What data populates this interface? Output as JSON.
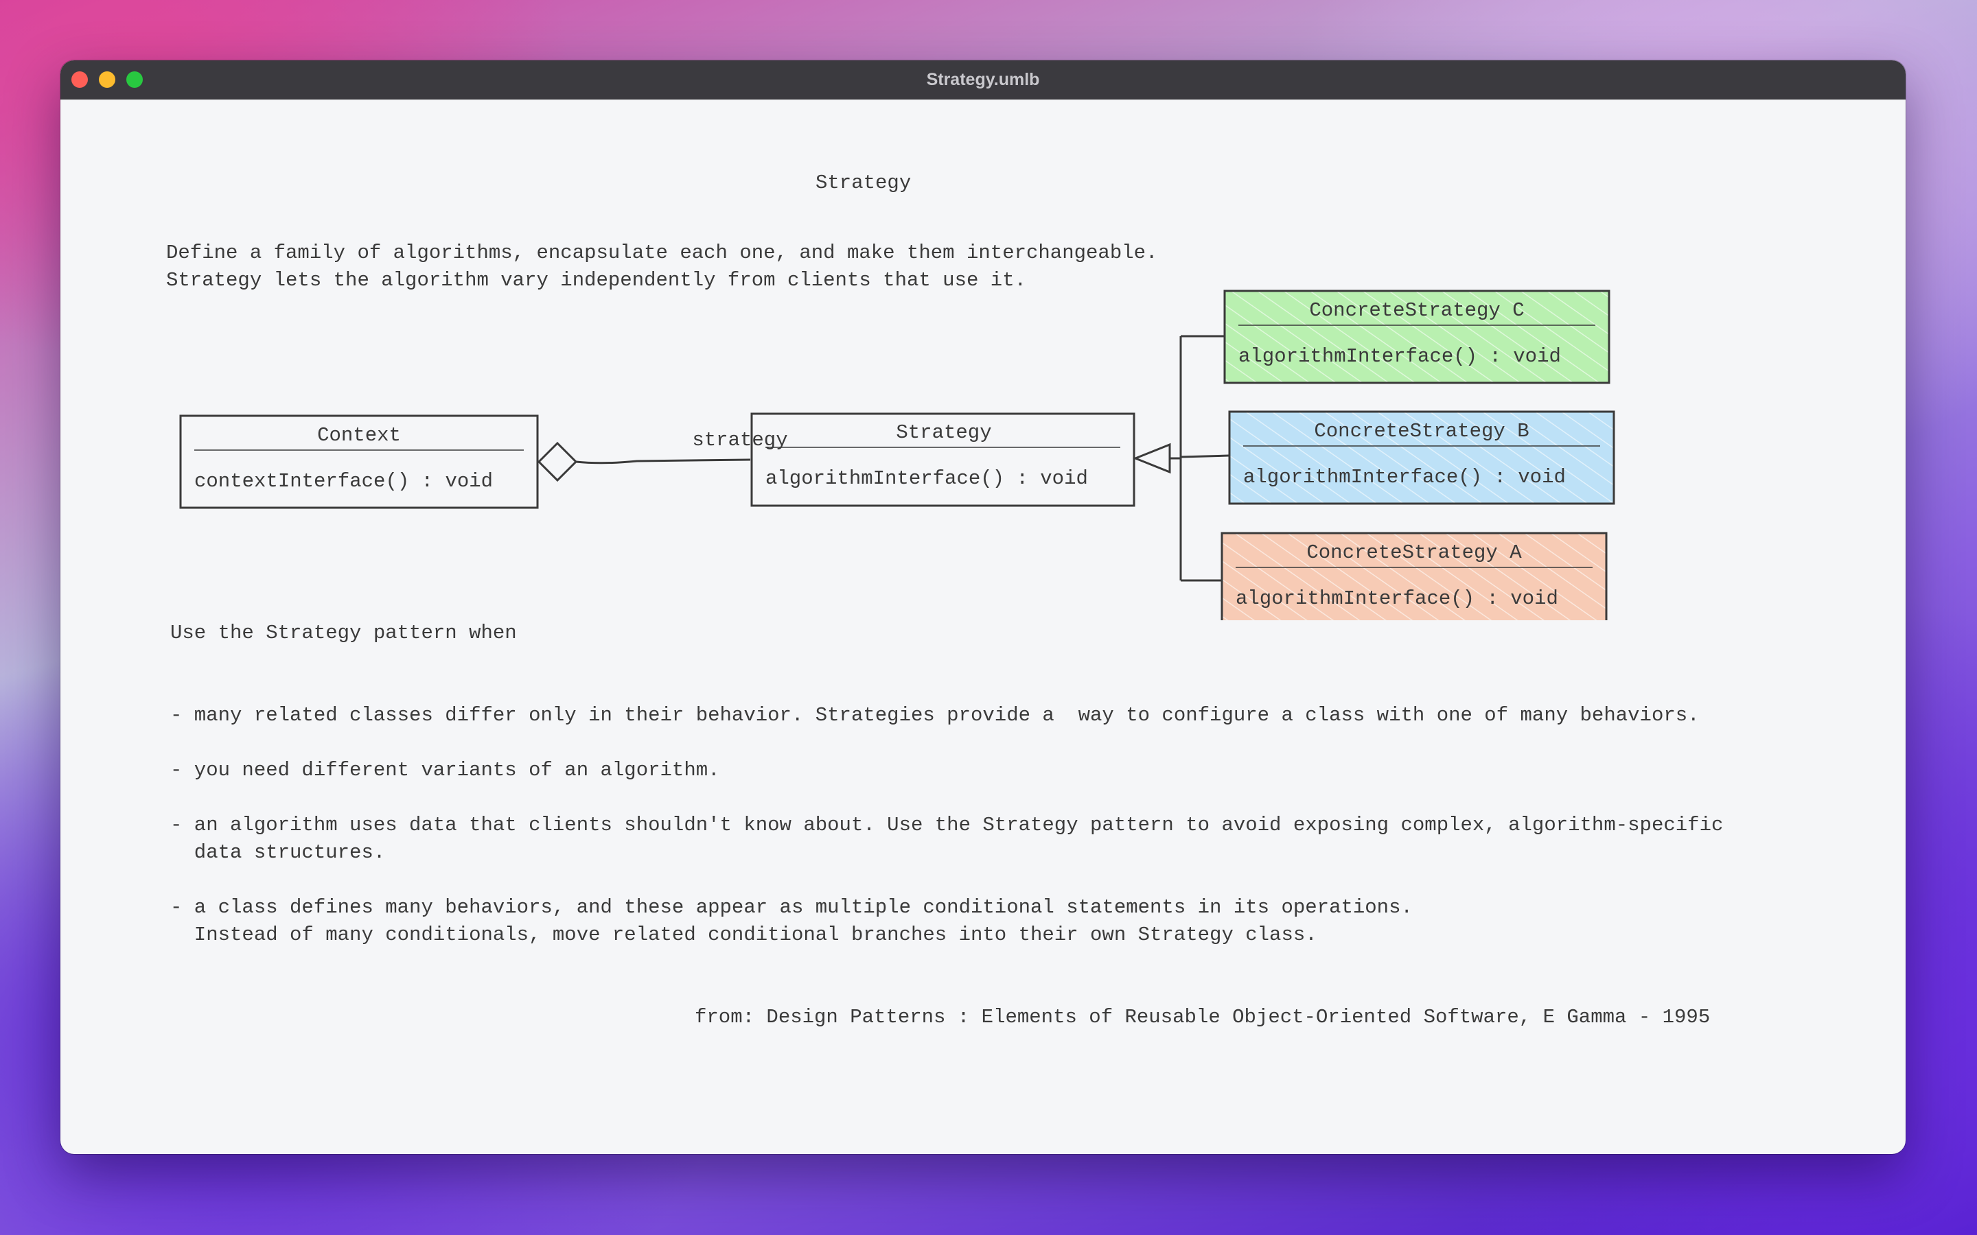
{
  "window": {
    "title": "Strategy.umlb"
  },
  "doc": {
    "heading": "Strategy",
    "intro": [
      "Define a family of algorithms, encapsulate each one, and make them interchangeable.",
      "Strategy lets the algorithm vary independently from clients that use it."
    ],
    "use_when": "Use the Strategy pattern when",
    "bullets": [
      "- many related classes differ only in their behavior. Strategies provide a  way to configure a class with one of many behaviors.",
      "- you need different variants of an algorithm.",
      "- an algorithm uses data that clients shouldn't know about. Use the Strategy pattern to avoid exposing complex, algorithm-specific",
      "  data structures.",
      "- a class defines many behaviors, and these appear as multiple conditional statements in its operations.",
      "  Instead of many conditionals, move related conditional branches into their own Strategy class."
    ],
    "citation": "from: Design Patterns : Elements of Reusable Object-Oriented Software, E Gamma - 1995"
  },
  "diagram": {
    "context": {
      "name": "Context",
      "method": "contextInterface() : void"
    },
    "association_label": "strategy",
    "strategy": {
      "name": "Strategy",
      "method": "algorithmInterface() : void"
    },
    "concrete_c": {
      "name": "ConcreteStrategy C",
      "method": "algorithmInterface() : void",
      "color": "#b9f0b0"
    },
    "concrete_b": {
      "name": "ConcreteStrategy B",
      "method": "algorithmInterface() : void",
      "color": "#bde1f7"
    },
    "concrete_a": {
      "name": "ConcreteStrategy A",
      "method": "algorithmInterface() : void",
      "color": "#f7cbb5"
    }
  }
}
